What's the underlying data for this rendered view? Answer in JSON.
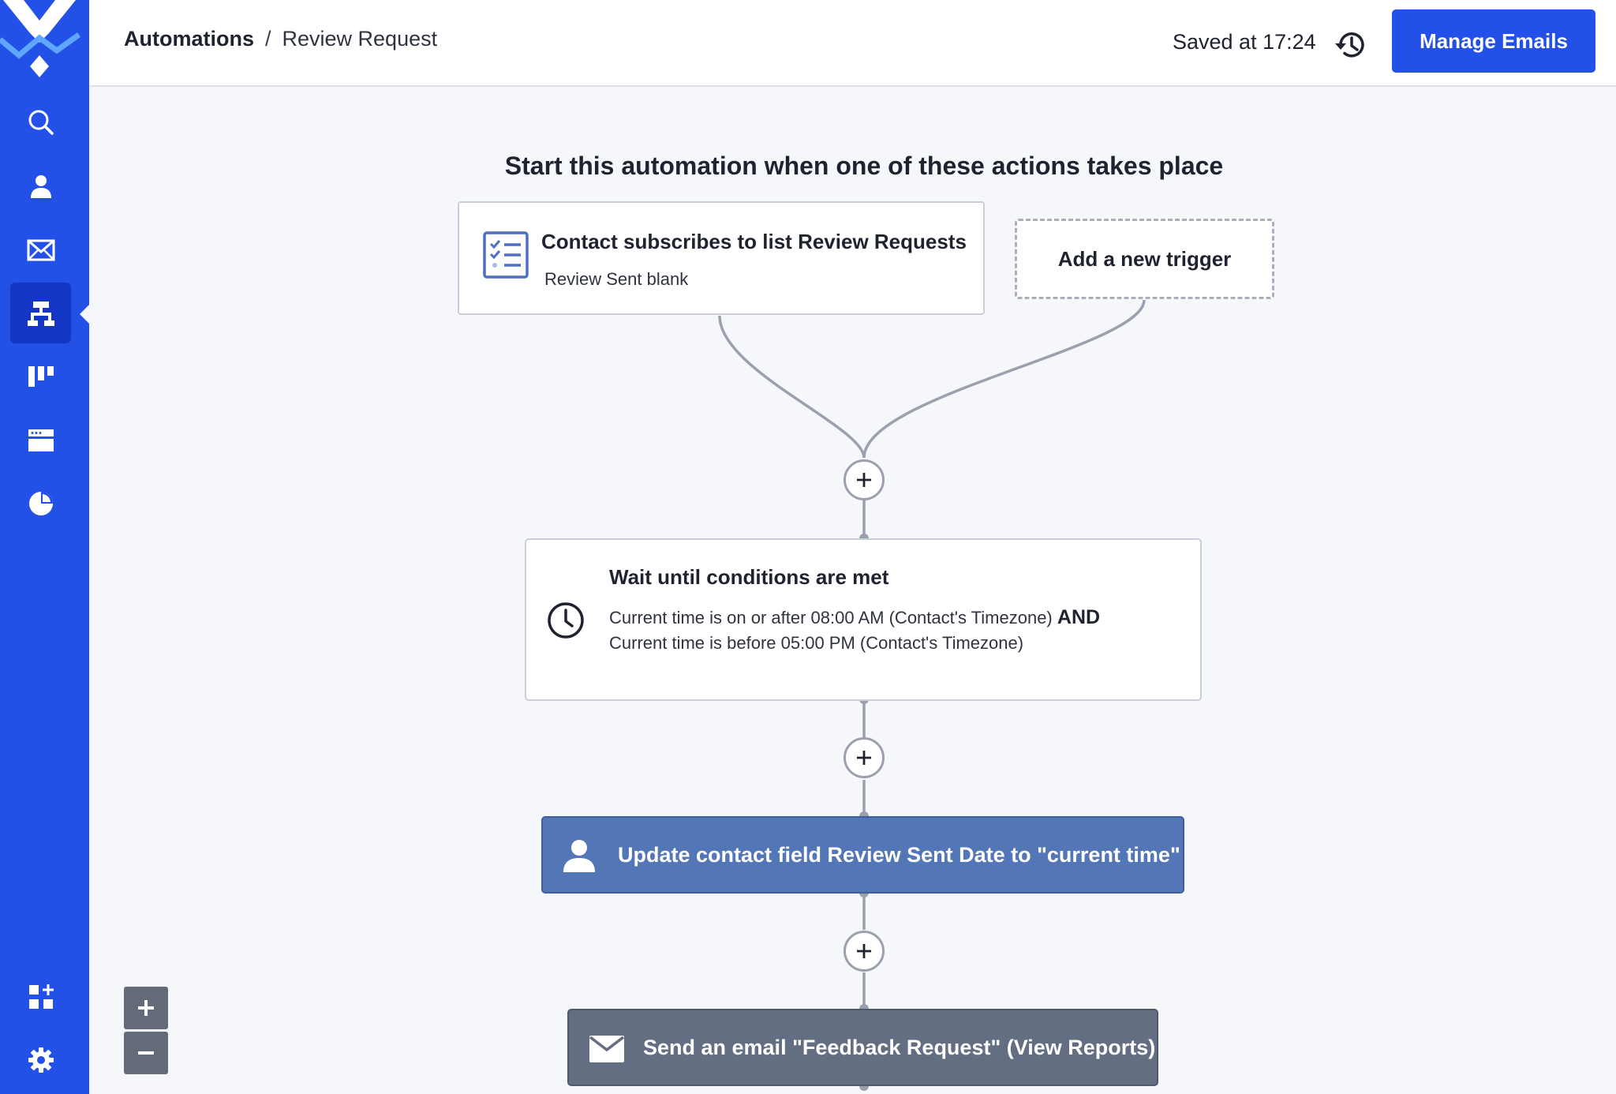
{
  "header": {
    "breadcrumb_root": "Automations",
    "breadcrumb_separator": "/",
    "breadcrumb_current": "Review Request",
    "saved_status": "Saved at 17:24",
    "manage_emails_label": "Manage Emails"
  },
  "sidebar": {
    "items": [
      {
        "name": "search",
        "icon": "search-icon"
      },
      {
        "name": "contacts",
        "icon": "person-icon"
      },
      {
        "name": "campaigns",
        "icon": "envelope-icon"
      },
      {
        "name": "automations",
        "icon": "automation-icon",
        "active": true
      },
      {
        "name": "deals",
        "icon": "pipeline-icon"
      },
      {
        "name": "website",
        "icon": "browser-window-icon"
      },
      {
        "name": "reports",
        "icon": "pie-chart-icon"
      },
      {
        "name": "apps",
        "icon": "apps-add-icon"
      },
      {
        "name": "settings",
        "icon": "gear-icon"
      }
    ]
  },
  "automation": {
    "heading": "Start this automation when one of these actions takes place",
    "trigger": {
      "title": "Contact subscribes to list Review Requests",
      "subtitle": "Review Sent blank"
    },
    "add_trigger_label": "Add a new trigger",
    "wait_step": {
      "title": "Wait until conditions are met",
      "condition_1": "Current time is on or after 08:00 AM (Contact's Timezone)",
      "operator": "AND",
      "condition_2": "Current time is before 05:00 PM (Contact's Timezone)"
    },
    "update_step": {
      "label": "Update contact field Review Sent Date to \"current time\""
    },
    "email_step": {
      "label": "Send an email \"Feedback Request\" (View Reports)"
    }
  },
  "colors": {
    "brand_blue": "#2351e8",
    "update_step": "#5276b6",
    "email_step": "#636e82"
  }
}
